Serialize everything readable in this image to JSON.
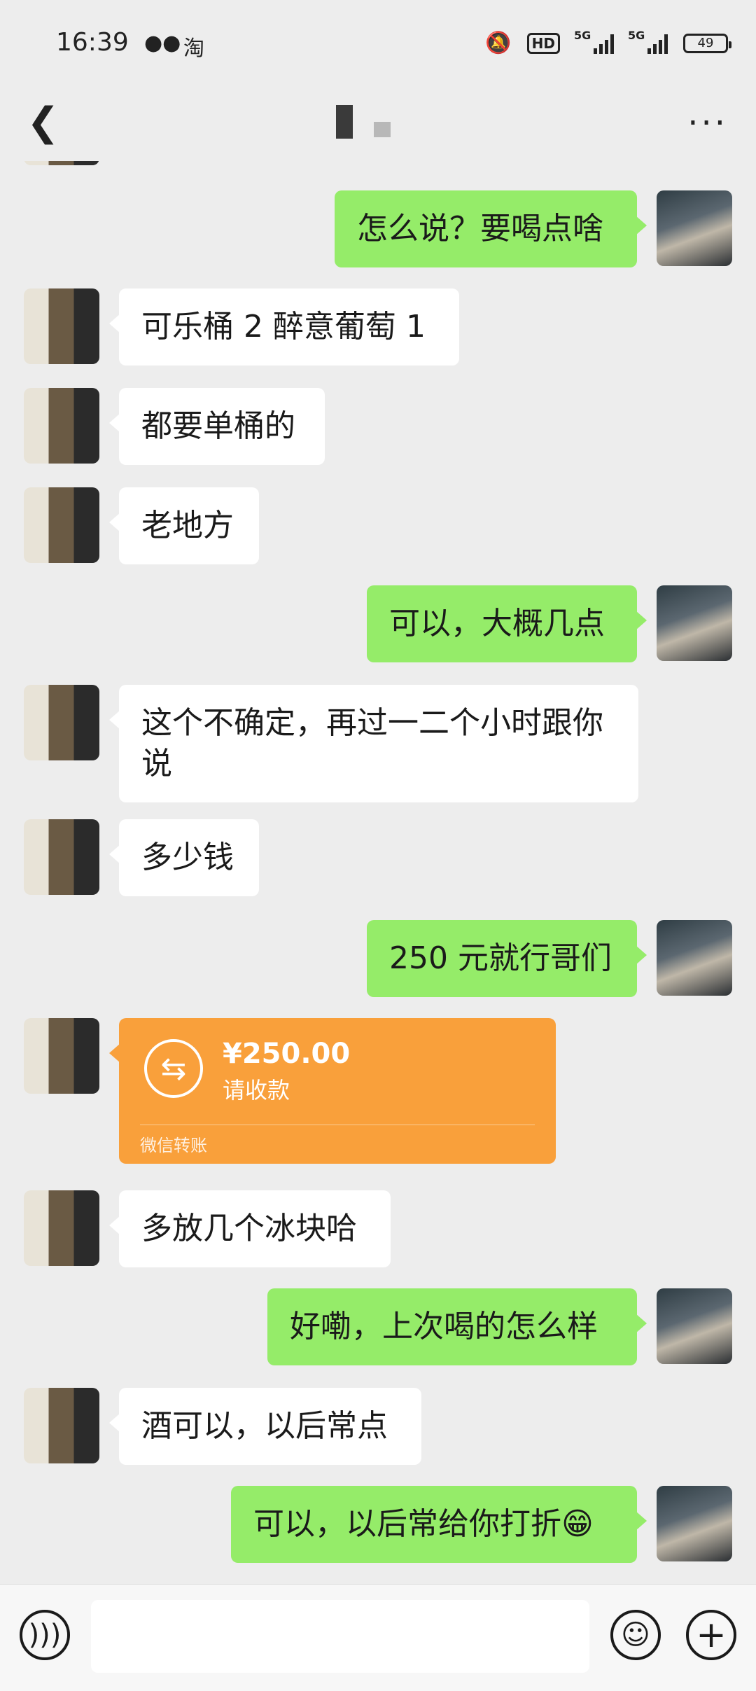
{
  "status_bar": {
    "time": "16:39",
    "app_icons": [
      "wechat-icon",
      "taobao-icon"
    ],
    "taobao_label": "淘",
    "hd_label": "HD",
    "signal_labels": [
      "5G",
      "5G"
    ],
    "battery": "49"
  },
  "header": {
    "title": "",
    "more_label": "..."
  },
  "messages": [
    {
      "side": "right",
      "text": "怎么说？要喝点啥"
    },
    {
      "side": "left",
      "text": "可乐桶 2 醉意葡萄 1"
    },
    {
      "side": "left",
      "text": "都要单桶的"
    },
    {
      "side": "left",
      "text": "老地方"
    },
    {
      "side": "right",
      "text": "可以，大概几点"
    },
    {
      "side": "left",
      "text": "这个不确定，再过一二个小时跟你说"
    },
    {
      "side": "left",
      "text": "多少钱"
    },
    {
      "side": "right",
      "text": "250 元就行哥们"
    },
    {
      "side": "left",
      "type": "transfer",
      "amount": "¥250.00",
      "status": "请收款",
      "source": "微信转账"
    },
    {
      "side": "left",
      "text": "多放几个冰块哈"
    },
    {
      "side": "right",
      "text": "好嘞，上次喝的怎么样"
    },
    {
      "side": "left",
      "text": "酒可以，以后常点"
    },
    {
      "side": "right",
      "text": "可以，以后常给你打折😁"
    }
  ],
  "input_bar": {
    "placeholder": "",
    "voice_icon": "voice-icon",
    "emoji_icon": "emoji-icon",
    "plus_icon": "plus-icon"
  }
}
